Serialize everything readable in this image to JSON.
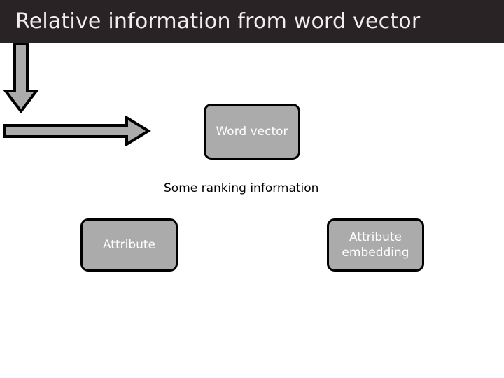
{
  "header": {
    "title": "Relative information from word vector",
    "background_color": "#2a2326",
    "text_color": "#f2eef0"
  },
  "slide": {
    "background_color": "#ffffff",
    "shape_fill_color": "#ababab",
    "shape_border_color": "#000000",
    "shape_text_color": "#ffffff",
    "caption_text_color": "#000000"
  },
  "nodes": [
    {
      "id": "word-vector",
      "label": "Word vector"
    },
    {
      "id": "attribute",
      "label": "Attribute"
    },
    {
      "id": "attribute-embedding",
      "label": "Attribute\nembedding"
    }
  ],
  "connectors": [
    {
      "id": "arrow-down",
      "direction": "down",
      "from": "word-vector",
      "to": "arrow-right"
    },
    {
      "id": "arrow-right",
      "direction": "right",
      "from": "attribute",
      "to": "attribute-embedding"
    }
  ],
  "captions": [
    {
      "id": "ranking-caption",
      "text": "Some ranking information"
    }
  ]
}
